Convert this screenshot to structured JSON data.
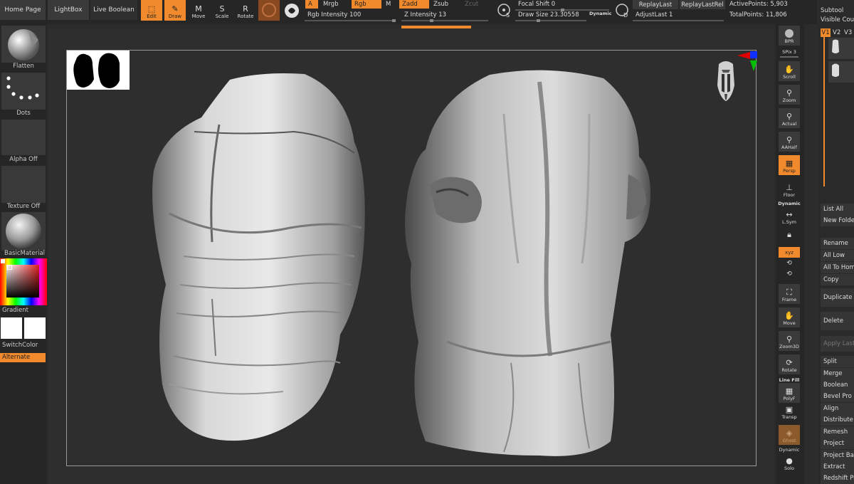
{
  "top": {
    "home_page": "Home Page",
    "lightbox": "LightBox",
    "live_boolean": "Live Boolean",
    "tools": [
      {
        "label": "Edit",
        "icon": "edit-icon",
        "active": true
      },
      {
        "label": "Draw",
        "icon": "draw-icon",
        "active": true
      },
      {
        "label": "Move",
        "icon": "move-icon",
        "active": false
      },
      {
        "label": "Scale",
        "icon": "scale-icon",
        "active": false
      },
      {
        "label": "Rotate",
        "icon": "rotate-icon",
        "active": false
      }
    ],
    "a_flag": "A",
    "mrgb": "Mrgb",
    "rgb": "Rgb",
    "m": "M",
    "rgb_intensity": "Rgb Intensity 100",
    "zadd": "Zadd",
    "zsub": "Zsub",
    "zcut": "Zcut",
    "z_intensity": "Z Intensity 13",
    "s_label": "S",
    "focal_shift": "Focal Shift 0",
    "draw_size": "Draw Size 23.30558",
    "dynamic": "Dynamic",
    "d_label": "D",
    "replay_last": "ReplayLast",
    "replay_last_rel": "ReplayLastRel",
    "adjust_last": "AdjustLast 1",
    "active_points": "ActivePoints: 5,903",
    "total_points": "TotalPoints: 11,806"
  },
  "left": {
    "flatten": "Flatten",
    "dots": "Dots",
    "alpha_off": "Alpha Off",
    "texture_off": "Texture Off",
    "material": "BasicMaterial",
    "gradient": "Gradient",
    "switch_color": "SwitchColor",
    "alternate": "Alternate"
  },
  "right": {
    "bpr": "BPR",
    "spix": "SPix 3",
    "scroll": "Scroll",
    "zoom": "Zoom",
    "actual": "Actual",
    "aahalf": "AAHalf",
    "persp": "Persp",
    "floor": "Floor",
    "dynamic": "Dynamic",
    "lsym": "L.Sym",
    "xyz": "xyz",
    "frame": "Frame",
    "move": "Move",
    "zoom3d": "Zoom3D",
    "rotate": "Rotate",
    "line_fill": "Line Fill",
    "polyf": "PolyF",
    "transp": "Transp",
    "ghost": "Ghost",
    "dynamic2": "Dynamic",
    "solo": "Solo"
  },
  "subtool": {
    "title": "Subtool",
    "visible_count": "Visible Count",
    "v1": "V1",
    "v2": "V2",
    "v3": "V3",
    "list_all": "List All",
    "new_folder": "New Folder",
    "rename": "Rename",
    "all_low": "All Low",
    "all_to_home": "All To Home",
    "copy": "Copy",
    "duplicate": "Duplicate",
    "delete": "Delete",
    "apply_last": "Apply Last",
    "split": "Split",
    "merge": "Merge",
    "boolean": "Boolean",
    "bevel_pro": "Bevel Pro",
    "align": "Align",
    "distribute": "Distribute",
    "remesh": "Remesh",
    "project": "Project",
    "project_basrelief": "Project BasRelief",
    "extract": "Extract",
    "redshift": "Redshift Proxy"
  },
  "colors": {
    "accent": "#f08a2c",
    "panel": "#262626",
    "button": "#3a3a3a"
  }
}
